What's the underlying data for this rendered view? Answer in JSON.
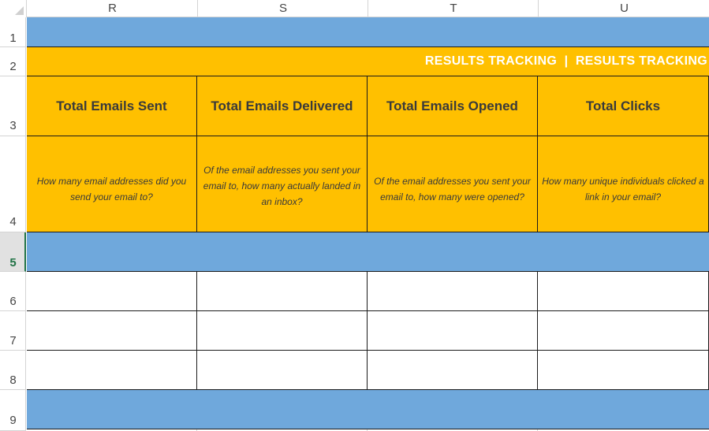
{
  "columns": [
    "R",
    "S",
    "T",
    "U"
  ],
  "rows": [
    "1",
    "2",
    "3",
    "4",
    "5",
    "6",
    "7",
    "8",
    "9"
  ],
  "selected_row": "5",
  "banner": {
    "title": "RESULTS TRACKING  |  RESULTS TRACKING"
  },
  "metrics": [
    {
      "title": "Total Emails Sent",
      "description": "How many email addresses did you send your email to?"
    },
    {
      "title": "Total Emails Delivered",
      "description": "Of the email addresses you sent your email to, how many actually landed in an inbox?"
    },
    {
      "title": "Total Emails Opened",
      "description": "Of the email addresses you sent your email to, how many were opened?"
    },
    {
      "title": "Total Clicks",
      "description": "How many unique individuals clicked a link in your email?"
    }
  ],
  "colors": {
    "band_blue": "#6fa8dc",
    "header_gold": "#ffc000",
    "banner_text": "#ffffff",
    "selected_row_accent": "#217346"
  }
}
